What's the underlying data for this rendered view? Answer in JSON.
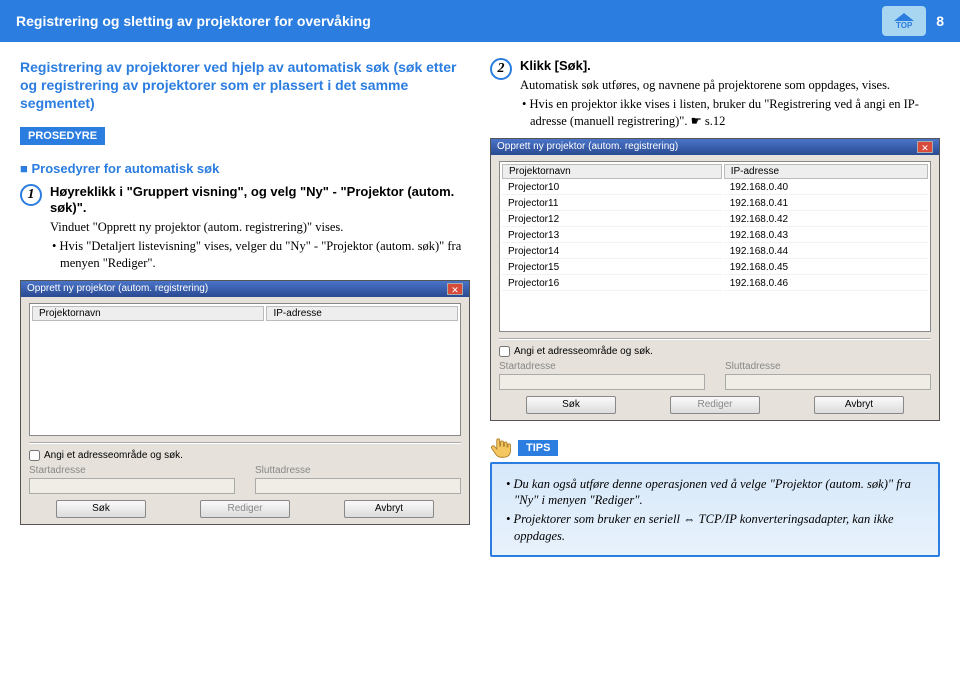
{
  "header": {
    "title": "Registrering og sletting av projektorer for overvåking",
    "top_label": "TOP",
    "page_number": "8"
  },
  "left": {
    "section_title": "Registrering av projektorer ved hjelp av automatisk søk (søk etter og registrering av projektorer som er plassert i det samme segmentet)",
    "procedure_badge": "PROSEDYRE",
    "sub_head": "Prosedyrer for automatisk søk",
    "step1": {
      "num": "1",
      "title": "Høyreklikk i \"Gruppert visning\", og velg \"Ny\" - \"Projektor (autom. søk)\".",
      "line1": "Vinduet \"Opprett ny projektor (autom. registrering)\" vises.",
      "line2": "Hvis \"Detaljert listevisning\" vises, velger du \"Ny\" - \"Projektor (autom. søk)\" fra menyen \"Rediger\"."
    },
    "dialog": {
      "title": "Opprett ny projektor (autom. registrering)",
      "col_name": "Projektornavn",
      "col_ip": "IP-adresse",
      "check": "Angi et adresseområde og søk.",
      "start": "Startadresse",
      "end": "Sluttadresse",
      "btn_search": "Søk",
      "btn_edit": "Rediger",
      "btn_cancel": "Avbryt"
    }
  },
  "right": {
    "step2": {
      "num": "2",
      "title": "Klikk [Søk].",
      "line1": "Automatisk søk utføres, og navnene på projektorene som oppdages, vises.",
      "line2": "Hvis en projektor ikke vises i listen, bruker du \"Registrering ved å angi en IP-adresse (manuell registrering)\". ☛ s.12"
    },
    "dialog": {
      "title": "Opprett ny projektor (autom. registrering)",
      "col_name": "Projektornavn",
      "col_ip": "IP-adresse",
      "rows": [
        {
          "name": "Projector10",
          "ip": "192.168.0.40"
        },
        {
          "name": "Projector11",
          "ip": "192.168.0.41"
        },
        {
          "name": "Projector12",
          "ip": "192.168.0.42"
        },
        {
          "name": "Projector13",
          "ip": "192.168.0.43"
        },
        {
          "name": "Projector14",
          "ip": "192.168.0.44"
        },
        {
          "name": "Projector15",
          "ip": "192.168.0.45"
        },
        {
          "name": "Projector16",
          "ip": "192.168.0.46"
        }
      ],
      "check": "Angi et adresseområde og søk.",
      "start": "Startadresse",
      "end": "Sluttadresse",
      "btn_search": "Søk",
      "btn_edit": "Rediger",
      "btn_cancel": "Avbryt"
    },
    "tips": {
      "label": "TIPS",
      "t1": "Du kan også utføre denne operasjonen ved å velge \"Projektor (autom. søk)\" fra \"Ny\" i menyen \"Rediger\".",
      "t2": "Projektorer som bruker en seriell ⇔ TCP/IP konverteringsadapter, kan ikke oppdages."
    }
  }
}
